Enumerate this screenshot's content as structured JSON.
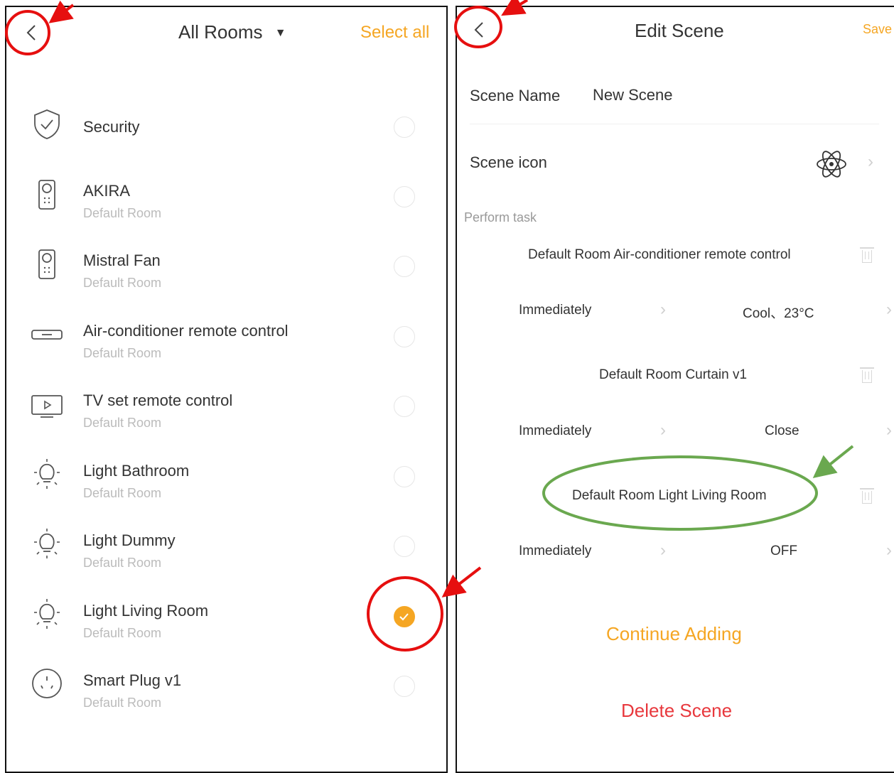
{
  "left": {
    "header": {
      "title": "All Rooms",
      "select_all": "Select all"
    },
    "devices": [
      {
        "name": "Security",
        "room": "",
        "icon": "shield-icon",
        "checked": false
      },
      {
        "name": "AKIRA",
        "room": "Default Room",
        "icon": "remote-icon",
        "checked": false
      },
      {
        "name": "Mistral Fan",
        "room": "Default Room",
        "icon": "remote-icon",
        "checked": false
      },
      {
        "name": "Air-conditioner remote control",
        "room": "Default Room",
        "icon": "air-conditioner-icon",
        "checked": false
      },
      {
        "name": "TV set remote control",
        "room": "Default Room",
        "icon": "tv-icon",
        "checked": false
      },
      {
        "name": "Light Bathroom",
        "room": "Default Room",
        "icon": "light-bulb-icon",
        "checked": false
      },
      {
        "name": "Light Dummy",
        "room": "Default Room",
        "icon": "light-bulb-icon",
        "checked": false
      },
      {
        "name": "Light Living Room",
        "room": "Default Room",
        "icon": "light-bulb-icon",
        "checked": true
      },
      {
        "name": "Smart Plug v1",
        "room": "Default Room",
        "icon": "plug-icon",
        "checked": false
      }
    ]
  },
  "right": {
    "header": {
      "title": "Edit Scene",
      "save": "Save"
    },
    "scene_name_label": "Scene Name",
    "scene_name_value": "New Scene",
    "scene_icon_label": "Scene icon",
    "scene_icon": "atom-icon",
    "perform_task_label": "Perform task",
    "tasks": [
      {
        "device": "Default Room Air-conditioner remote control",
        "timing": "Immediately",
        "action": "Cool、23°C"
      },
      {
        "device": "Default Room Curtain v1",
        "timing": "Immediately",
        "action": "Close"
      },
      {
        "device": "Default Room Light Living Room",
        "timing": "Immediately",
        "action": "OFF"
      }
    ],
    "continue_adding": "Continue Adding",
    "delete_scene": "Delete Scene"
  },
  "colors": {
    "accent": "#f5a623",
    "delete": "#e8383d",
    "annotation_red": "#e60f0f",
    "annotation_green": "#6aa84f"
  }
}
